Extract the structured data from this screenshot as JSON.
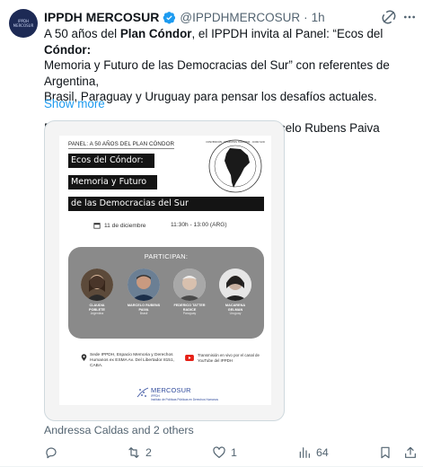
{
  "account": {
    "display_name": "IPPDH MERCOSUR",
    "handle": "@IPPDHMERCOSUR",
    "separator": "·",
    "time": "1h"
  },
  "tweet": {
    "line1_a": "A 50 años del ",
    "line1_b": "Plan Cóndor",
    "line1_c": ", el IPPDH invita al Panel: “Ecos del ",
    "line1_d": "Cóndor",
    "line1_e": ":",
    "line2": "Memoria y Futuro de las Democracias del Sur” con referentes de Argentina,",
    "line3": "Brasil, Paraguay y Uruguay para pensar los desafíos actuales.",
    "line4": "Participan: Claudia Poblete (Argentina); Marcelo Rubens Paiva (Brasil);",
    "show_more": "Show more"
  },
  "poster": {
    "kicker": "PANEL: A 50 AÑOS DEL PLAN CÓNDOR",
    "title_1": "Ecos del Cóndor:",
    "title_2": "Memoria y Futuro",
    "title_3": "de las Democracias del Sur",
    "seal_text": "CONVENCIÓN · DERECHOS HUMANOS · CONO SUR",
    "date": "11 de diciembre",
    "time": "11:30h - 13:00 (ARG)",
    "panel_title": "PARTICIPAN:",
    "people": [
      {
        "name": "CLAUDIA\nPOBLETE",
        "country": "Argentina"
      },
      {
        "name": "MARCELO RUBENS\nPAIVA",
        "country": "Brasil"
      },
      {
        "name": "FEDERICO TATTER\nRADICE",
        "country": "Paraguay"
      },
      {
        "name": "MACARENA\nGELMAN",
        "country": "Uruguay"
      }
    ],
    "venue": "Sede IPPDH, Espacio Memoria y Derechos Humanos ex ESMA Av. Del Libertador 8151, CABA.",
    "stream": "Transmisión en vivo por el canal de YouTube del IPPDH",
    "logo_name": "MERCOSUR",
    "logo_sub": "IPPDH",
    "logo_sub2": "Instituto de Políticas Públicas en Derechos Humanos"
  },
  "tagged": "Andressa Caldas and 2 others",
  "actions": {
    "reply_count": "",
    "retweet_count": "2",
    "like_count": "1",
    "views_count": "64"
  },
  "colors": {
    "link": "#1d9bf0",
    "muted": "#536471",
    "verified": "#1d9bf0",
    "panel_grey": "#8a8a8a",
    "band": "#141414"
  },
  "icons": [
    "verified-badge-icon",
    "grok-icon",
    "more-icon",
    "calendar-icon",
    "clock-icon",
    "location-pin-icon",
    "youtube-icon",
    "reply-icon",
    "retweet-icon",
    "like-icon",
    "views-icon",
    "bookmark-icon",
    "share-icon"
  ]
}
